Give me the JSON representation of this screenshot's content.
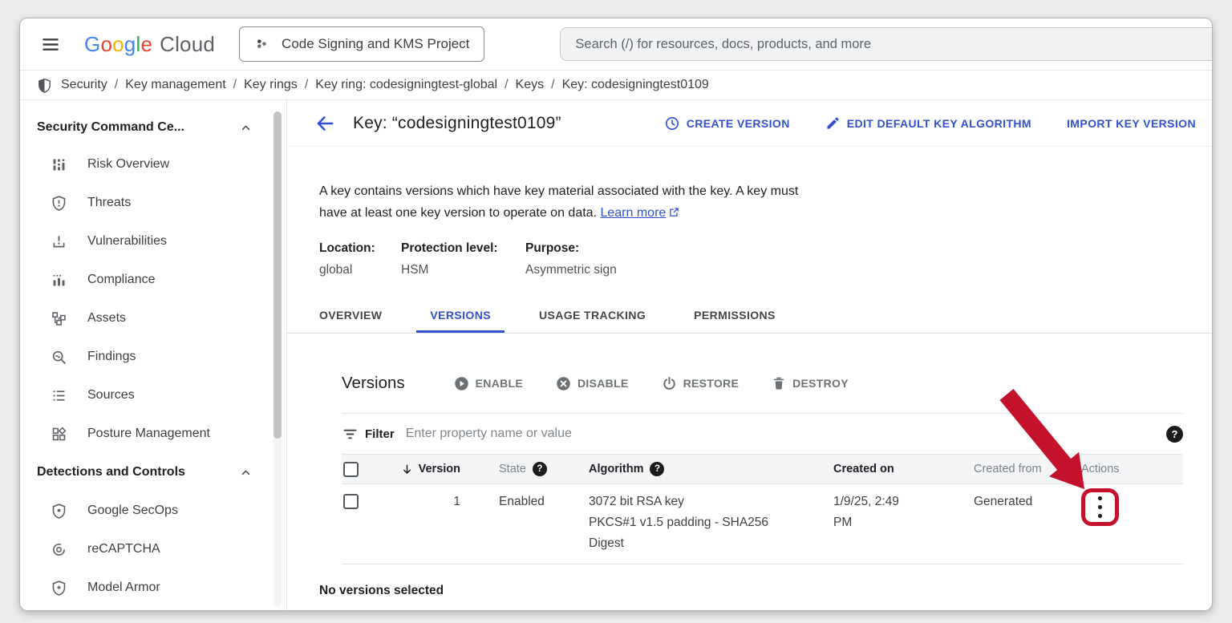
{
  "colors": {
    "accent": "#3150d2",
    "annotation_red": "#c4122d",
    "logo_blue": "#4285F4",
    "logo_red": "#EA4335",
    "logo_yellow": "#F4B400",
    "logo_green": "#34A853",
    "text_dark": "#202124",
    "text_gray": "#5f6368",
    "table_header_bg": "#f4f5f7",
    "border_light": "#e4e6e9"
  },
  "topbar": {
    "logo_letters": [
      {
        "ch": "G"
      },
      {
        "ch": "o"
      },
      {
        "ch": "o"
      },
      {
        "ch": "g"
      },
      {
        "ch": "l"
      },
      {
        "ch": "e"
      }
    ],
    "logo_cloud": "Cloud",
    "project_name": "Code Signing and KMS Project",
    "search_placeholder": "Search (/) for resources, docs, products, and more"
  },
  "breadcrumb": {
    "separator": "/",
    "items": [
      "Security",
      "Key management",
      "Key rings",
      "Key ring: codesigningtest-global",
      "Keys",
      "Key: codesigningtest0109"
    ]
  },
  "sidebar": {
    "sections": [
      {
        "title": "Security Command Ce...",
        "items": [
          {
            "label": "Risk Overview"
          },
          {
            "label": "Threats"
          },
          {
            "label": "Vulnerabilities"
          },
          {
            "label": "Compliance"
          },
          {
            "label": "Assets"
          },
          {
            "label": "Findings"
          },
          {
            "label": "Sources"
          },
          {
            "label": "Posture Management"
          }
        ]
      },
      {
        "title": "Detections and Controls",
        "items": [
          {
            "label": "Google SecOps"
          },
          {
            "label": "reCAPTCHA"
          },
          {
            "label": "Model Armor"
          }
        ]
      }
    ]
  },
  "main": {
    "title": "Key: “codesigningtest0109”",
    "actions": [
      {
        "label": "CREATE VERSION"
      },
      {
        "label": "EDIT DEFAULT KEY ALGORITHM"
      },
      {
        "label": "IMPORT KEY VERSION"
      }
    ],
    "description": {
      "line1": "A key contains versions which have key material associated with the key. A key must",
      "line2": "have at least one key version to operate on data.",
      "learn_more": "Learn more"
    },
    "meta": [
      {
        "label": "Location:",
        "value": "global"
      },
      {
        "label": "Protection level:",
        "value": "HSM"
      },
      {
        "label": "Purpose:",
        "value": "Asymmetric sign"
      }
    ],
    "tabs": [
      {
        "label": "OVERVIEW"
      },
      {
        "label": "VERSIONS"
      },
      {
        "label": "USAGE TRACKING"
      },
      {
        "label": "PERMISSIONS"
      }
    ],
    "active_tab": "VERSIONS"
  },
  "versions": {
    "heading": "Versions",
    "toolbar": [
      {
        "label": "ENABLE"
      },
      {
        "label": "DISABLE"
      },
      {
        "label": "RESTORE"
      },
      {
        "label": "DESTROY"
      }
    ],
    "filter": {
      "label": "Filter",
      "placeholder": "Enter property name or value"
    },
    "help_glyph": "?",
    "table": {
      "headers": {
        "version": "Version",
        "state": "State",
        "algorithm": "Algorithm",
        "created_on": "Created on",
        "created_from": "Created from",
        "actions": "Actions"
      },
      "rows": [
        {
          "version": "1",
          "state": "Enabled",
          "algorithm_lines": [
            "3072 bit RSA key",
            "PKCS#1 v1.5 padding - SHA256",
            "Digest"
          ],
          "created_on_lines": [
            "1/9/25, 2:49",
            "PM"
          ],
          "created_from": "Generated"
        }
      ]
    },
    "footer": "No versions selected"
  }
}
